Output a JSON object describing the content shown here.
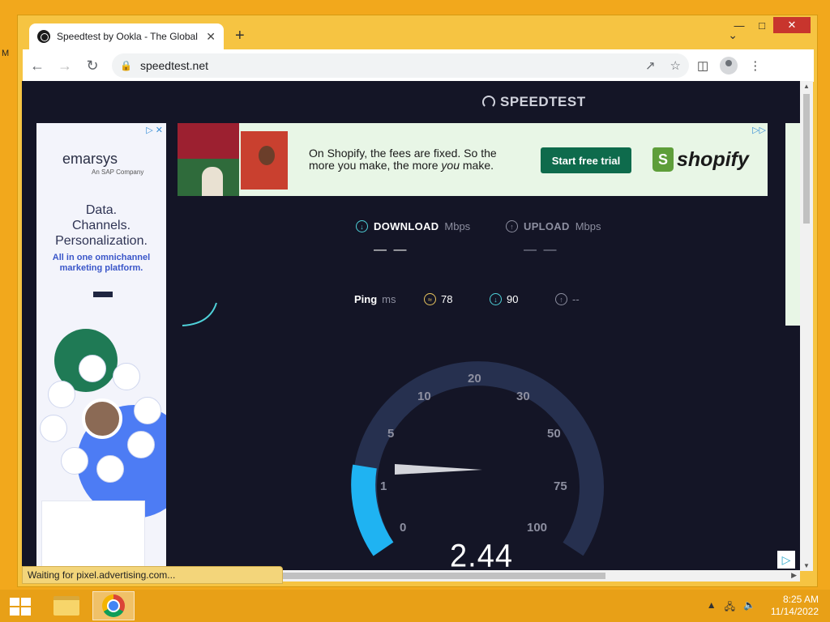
{
  "browser": {
    "tab_title": "Speedtest by Ookla - The Global",
    "url": "speedtest.net",
    "status_text": "Waiting for pixel.advertising.com..."
  },
  "page": {
    "logo": "SPEEDTEST",
    "download_label": "DOWNLOAD",
    "upload_label": "UPLOAD",
    "unit": "Mbps",
    "download_value": "— —",
    "upload_value": "— —",
    "ping_label": "Ping",
    "ping_unit": "ms",
    "ping_idle": "78",
    "ping_download": "90",
    "ping_upload": "--",
    "gauge_value": "2.44",
    "gauge_labels": [
      "0",
      "1",
      "5",
      "10",
      "20",
      "30",
      "50",
      "75",
      "100"
    ],
    "gauge_progress_fraction": 0.25
  },
  "ads": {
    "left": {
      "brand": "emarsys",
      "brand_sub": "An SAP Company",
      "headline_1": "Data.",
      "headline_2": "Channels.",
      "headline_3": "Personalization.",
      "subline_1": "All in one omnichannel",
      "subline_2": "marketing platform."
    },
    "top": {
      "text_1": "On Shopify, the fees are fixed. So the",
      "text_2a": "more you make, the more ",
      "text_2b": "you",
      "text_2c": " make.",
      "button": "Start free trial",
      "brand": "shopify"
    }
  },
  "taskbar": {
    "time": "8:25 AM",
    "date": "11/14/2022"
  },
  "colors": {
    "page_bg": "#141526",
    "accent_cyan": "#4fd1d9",
    "gauge_track": "#26304f",
    "gauge_fill": "#1fb3f2",
    "shopify_button": "#0e6b4c"
  }
}
